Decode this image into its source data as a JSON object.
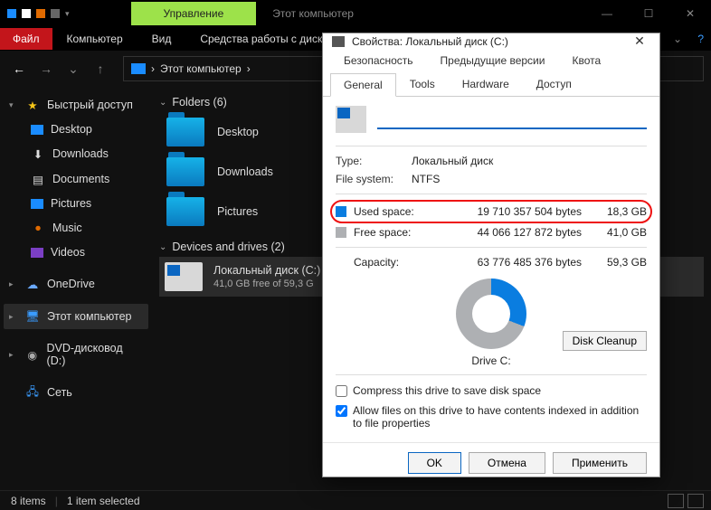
{
  "window": {
    "title": "Этот компьютер",
    "ribbon_tab": "Управление"
  },
  "menu": {
    "file": "Файл",
    "computer": "Компьютер",
    "view": "Вид",
    "disk_tools": "Средства работы с диска"
  },
  "address": {
    "path": "Этот компьютер",
    "sep": "›"
  },
  "sidebar": {
    "quick": "Быстрый доступ",
    "items": [
      "Desktop",
      "Downloads",
      "Documents",
      "Pictures",
      "Music",
      "Videos"
    ],
    "onedrive": "OneDrive",
    "this_pc": "Этот компьютер",
    "dvd": "DVD-дисковод (D:)",
    "network": "Сеть"
  },
  "content": {
    "folders_hdr": "Folders (6)",
    "folders": [
      "Desktop",
      "Downloads",
      "Pictures"
    ],
    "devices_hdr": "Devices and drives (2)",
    "drive": {
      "name": "Локальный диск (C:)",
      "sub": "41,0 GB free of 59,3 G"
    }
  },
  "status": {
    "items": "8 items",
    "selected": "1 item selected"
  },
  "dialog": {
    "title": "Свойства: Локальный диск (C:)",
    "tabs_row1": [
      "Безопасность",
      "Предыдущие версии",
      "Квота"
    ],
    "tabs_row2": [
      "General",
      "Tools",
      "Hardware",
      "Доступ"
    ],
    "type_label": "Type:",
    "type_value": "Локальный диск",
    "fs_label": "File system:",
    "fs_value": "NTFS",
    "used_label": "Used space:",
    "used_bytes": "19 710 357 504 bytes",
    "used_gb": "18,3 GB",
    "free_label": "Free space:",
    "free_bytes": "44 066 127 872 bytes",
    "free_gb": "41,0 GB",
    "cap_label": "Capacity:",
    "cap_bytes": "63 776 485 376 bytes",
    "cap_gb": "59,3 GB",
    "drive_caption": "Drive C:",
    "cleanup": "Disk Cleanup",
    "compress": "Compress this drive to save disk space",
    "index": "Allow files on this drive to have contents indexed in addition to file properties",
    "ok": "OK",
    "cancel": "Отмена",
    "apply": "Применить"
  }
}
